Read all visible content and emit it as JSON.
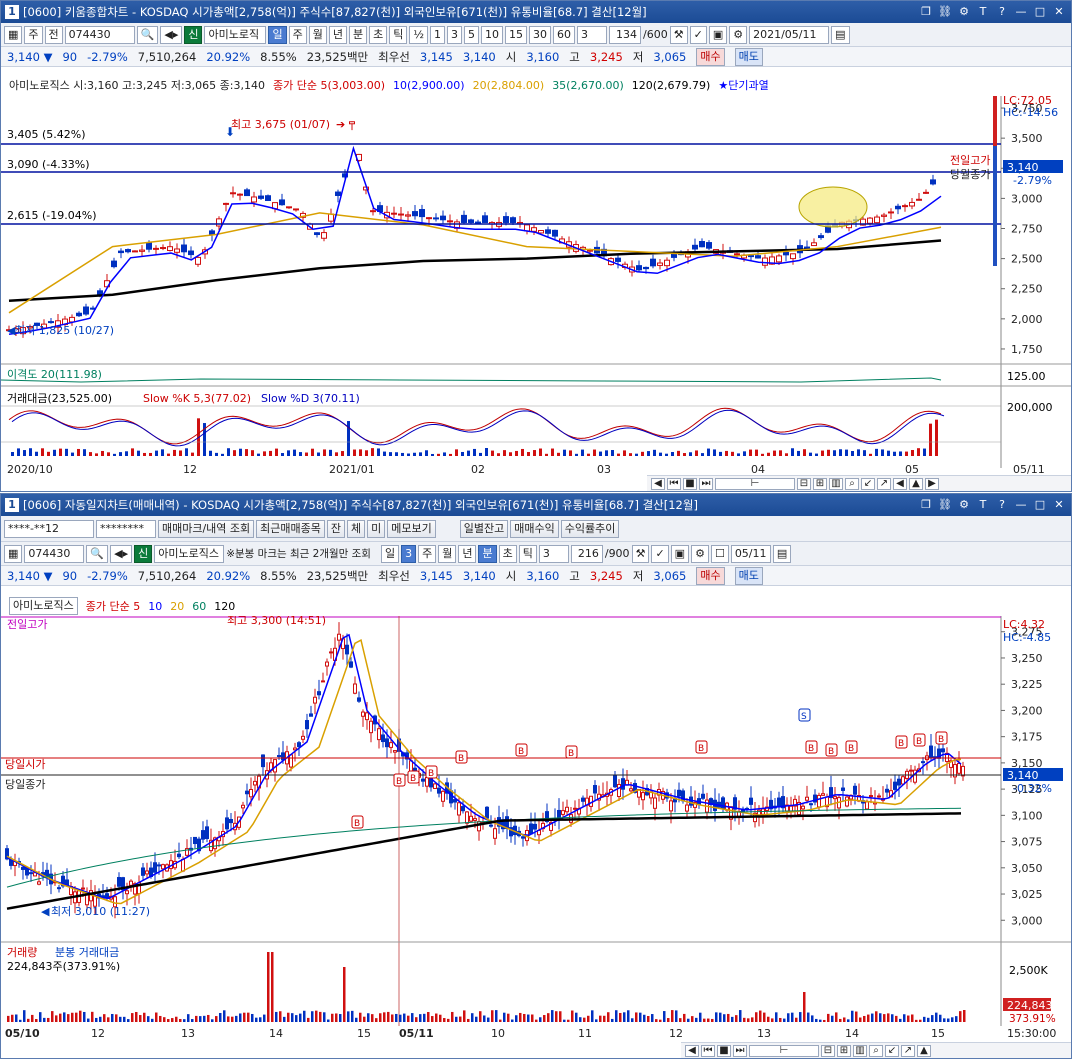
{
  "top": {
    "window_num": "1",
    "title": "[0600] 키움종합차트 - KOSDAQ 시가총액[2,758(억)] 주식수[87,827(천)] 외국인보유[671(천)] 유통비율[68.7] 결산[12월]",
    "toolbar": {
      "period": "주",
      "front": "전",
      "code": "074430",
      "badge": "신",
      "name": "아미노로직",
      "tabs": [
        "일",
        "주",
        "월",
        "년",
        "분",
        "초",
        "틱"
      ],
      "active_tab": "일",
      "frac": "½",
      "nums": [
        "1",
        "3",
        "5",
        "10",
        "15",
        "30",
        "60"
      ],
      "sel": "3",
      "count": "134",
      "max": "600",
      "date": "2021/05/11"
    },
    "quote": {
      "price": "3,140",
      "arrow": "▼",
      "change": "90",
      "rate": "-2.79%",
      "volume": "7,510,264",
      "vol_ratio": "20.92%",
      "turnover": "8.55%",
      "amount": "23,525백만",
      "best_label": "최우선",
      "best_sell": "3,145",
      "best_buy": "3,140",
      "open_label": "시",
      "open": "3,160",
      "high_label": "고",
      "high": "3,245",
      "low_label": "저",
      "low": "3,065",
      "buy": "매수",
      "sell": "매도"
    },
    "legend": {
      "info": "아미노로직스 시:3,160 고:3,245 저:3,065 종:3,140",
      "ma_label": "종가 단순 5(3,003.00)",
      "ma10": "10(2,900.00)",
      "ma20": "20(2,804.00)",
      "ma35": "35(2,670.00)",
      "ma120": "120(2,679.79)",
      "signal": "★단기과열"
    },
    "annotations": {
      "lc": "LC:72.05",
      "hc": "HC:-14.56",
      "high_mark": "최고 3,675 (01/07)",
      "low_mark": "최저 1,825 (10/27)",
      "line1": "3,405 (5.42%)",
      "line2": "3,090 (-4.33%)",
      "line3": "2,615 (-19.04%)",
      "prev_high": "전일고가",
      "month_close": "당월종가",
      "price_tag": "3,140",
      "pct_tag": "-2.79%"
    },
    "y_ticks": [
      "3,750",
      "3,500",
      "3,250",
      "3,000",
      "2,750",
      "2,500",
      "2,250",
      "2,000",
      "1,750"
    ],
    "sub1_label": "이격도 20(111.98)",
    "sub1_tick": "125.00",
    "sub2_label": "거래대금(23,525.00)",
    "sub2_k": "Slow %K 5,3(77.02)",
    "sub2_d": "Slow %D 3(70.11)",
    "sub2_tick": "200,000",
    "x_dates": [
      "2020/10",
      "12",
      "2021/01",
      "02",
      "03",
      "04",
      "05"
    ],
    "x_last": "05/11"
  },
  "bottom": {
    "window_num": "1",
    "title": "[0606] 자동일지차트(매매내역) - KOSDAQ 시가총액[2,758(억)] 주식수[87,827(천)] 외국인보유[671(천)] 유통비율[68.7] 결산[12월]",
    "row1": {
      "account": "****-**12",
      "password": "********",
      "mark_btn": "매매마크/내역 조회",
      "recent_btn": "최근매매종목",
      "a": "잔",
      "b": "체",
      "c": "미",
      "memo": "메모보기",
      "daily": "일별잔고",
      "profit": "매매수익",
      "trend": "수익률추이"
    },
    "row2": {
      "code": "074430",
      "badge": "신",
      "name": "아미노로직스",
      "note": "※분봉 마크는 최근 2개월만 조회",
      "day": "일",
      "sel1": "3",
      "tabs": [
        "주",
        "월",
        "년",
        "분",
        "초",
        "틱"
      ],
      "active_tab": "분",
      "sel2": "3",
      "count": "216",
      "max": "900",
      "date": "05/11"
    },
    "quote": {
      "price": "3,140",
      "arrow": "▼",
      "change": "90",
      "rate": "-2.79%",
      "volume": "7,510,264",
      "vol_ratio": "20.92%",
      "turnover": "8.55%",
      "amount": "23,525백만",
      "best_label": "최우선",
      "best_sell": "3,145",
      "best_buy": "3,140",
      "open_label": "시",
      "open": "3,160",
      "high_label": "고",
      "high": "3,245",
      "low_label": "저",
      "low": "3,065",
      "buy": "매수",
      "sell": "매도"
    },
    "legend": {
      "name": "아미노로직스",
      "ma_label": "종가 단순 5",
      "ma10": "10",
      "ma20": "20",
      "ma60": "60",
      "ma120": "120"
    },
    "annotations": {
      "lc": "LC:4.32",
      "hc": "HC:-4.85",
      "prev_high": "전일고가",
      "high_mark": "최고 3,300 (14:51)",
      "low_mark": "최저 3,010 (11:27)",
      "today_open": "당일시가",
      "today_close": "당일종가",
      "price_tag": "3,140",
      "pct_tag": "-0.32%",
      "s_mark": "S",
      "b_mark": "B"
    },
    "y_ticks": [
      "3,275",
      "3,250",
      "3,225",
      "3,200",
      "3,175",
      "3,150",
      "3,125",
      "3,100",
      "3,075",
      "3,050",
      "3,025",
      "3,000"
    ],
    "vol_label": "거래량",
    "vol_label2": "분봉 거래대금",
    "vol_value": "224,843주(373.91%)",
    "vol_tick": "2,500K",
    "vol_tag": "224,843",
    "vol_pct": "373.91%",
    "x_dates": [
      "05/10",
      "12",
      "13",
      "14",
      "15",
      "05/11",
      "10",
      "11",
      "12",
      "13",
      "14",
      "15"
    ],
    "x_last": "15:30:00"
  },
  "chart_data": [
    {
      "type": "candlestick",
      "title": "아미노로직스 일봉",
      "ylim": [
        1650,
        3850
      ],
      "reference_lines": [
        3405,
        3090,
        2615
      ],
      "high": 3675,
      "low": 1825,
      "close": 3140,
      "x": [
        "2020/10",
        "12",
        "2021/01",
        "02",
        "03",
        "04",
        "05"
      ],
      "series": [
        {
          "name": "120",
          "values": [
            2150,
            2200,
            2320,
            2420,
            2480,
            2500,
            2540,
            2560,
            2580,
            2650
          ]
        },
        {
          "name": "20",
          "values": [
            2050,
            2600,
            2700,
            2880,
            2780,
            2600,
            2560,
            2520,
            2600,
            2760
          ]
        }
      ]
    },
    {
      "type": "candlestick",
      "title": "아미노로직스 3분봉",
      "ylim": [
        2985,
        3290
      ],
      "high": 3300,
      "low": 3010,
      "close": 3140,
      "open_line": 3157,
      "close_line": 3140,
      "x": [
        "05/10",
        "12",
        "13",
        "14",
        "15",
        "05/11",
        "10",
        "11",
        "12",
        "13",
        "14",
        "15"
      ]
    }
  ]
}
